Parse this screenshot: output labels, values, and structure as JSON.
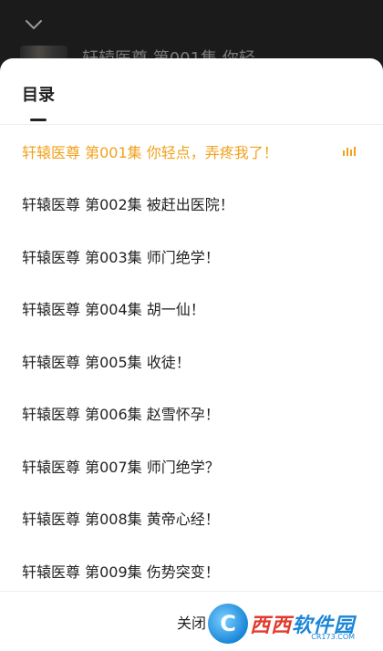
{
  "player": {
    "now_playing_title": "轩辕医尊 第001集 你轻",
    "collapse_icon": "chevron-down-icon"
  },
  "sheet": {
    "title": "目录",
    "close_label": "关闭",
    "accent_color": "#f0a21c"
  },
  "episodes": [
    {
      "label": "轩辕医尊 第001集 你轻点，弄疼我了！",
      "active": true
    },
    {
      "label": "轩辕医尊 第002集 被赶出医院！",
      "active": false
    },
    {
      "label": "轩辕医尊 第003集 师门绝学！",
      "active": false
    },
    {
      "label": "轩辕医尊 第004集 胡一仙！",
      "active": false
    },
    {
      "label": "轩辕医尊 第005集 收徒！",
      "active": false
    },
    {
      "label": "轩辕医尊 第006集 赵雪怀孕！",
      "active": false
    },
    {
      "label": "轩辕医尊 第007集 师门绝学？",
      "active": false
    },
    {
      "label": "轩辕医尊 第008集 黄帝心经！",
      "active": false
    },
    {
      "label": "轩辕医尊 第009集 伤势突变！",
      "active": false
    }
  ],
  "watermark": {
    "logo_letter": "C",
    "xixi": "西西",
    "ruanjian": "软件园",
    "url": "CR173.COM"
  }
}
